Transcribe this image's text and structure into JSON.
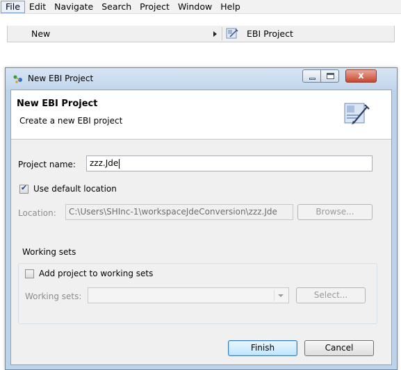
{
  "menubar": {
    "items": [
      "File",
      "Edit",
      "Navigate",
      "Search",
      "Project",
      "Window",
      "Help"
    ]
  },
  "submenu": {
    "new_label": "New",
    "ebi_project_label": "EBI Project",
    "ebi_icon": "ebi-project-icon"
  },
  "dialog": {
    "title": "New EBI Project",
    "header_title": "New EBI Project",
    "header_subtitle": "Create a new EBI project",
    "project_name_label": "Project name:",
    "project_name_value": "zzz.Jde",
    "use_default_location_label": "Use default location",
    "use_default_location_checked": true,
    "location_label": "Location:",
    "location_value": "C:\\Users\\SHInc-1\\workspaceJdeConversion\\zzz.Jde",
    "browse_label": "Browse...",
    "working_sets_group_label": "Working sets",
    "add_to_working_sets_label": "Add project to working sets",
    "add_to_working_sets_checked": false,
    "working_sets_label": "Working sets:",
    "working_sets_value": "",
    "select_label": "Select...",
    "finish_label": "Finish",
    "cancel_label": "Cancel",
    "close_glyph": "x"
  },
  "colors": {
    "title_bar": "#c2d6ec",
    "close_button": "#c9462c",
    "dialog_body": "#f0f0f0"
  }
}
